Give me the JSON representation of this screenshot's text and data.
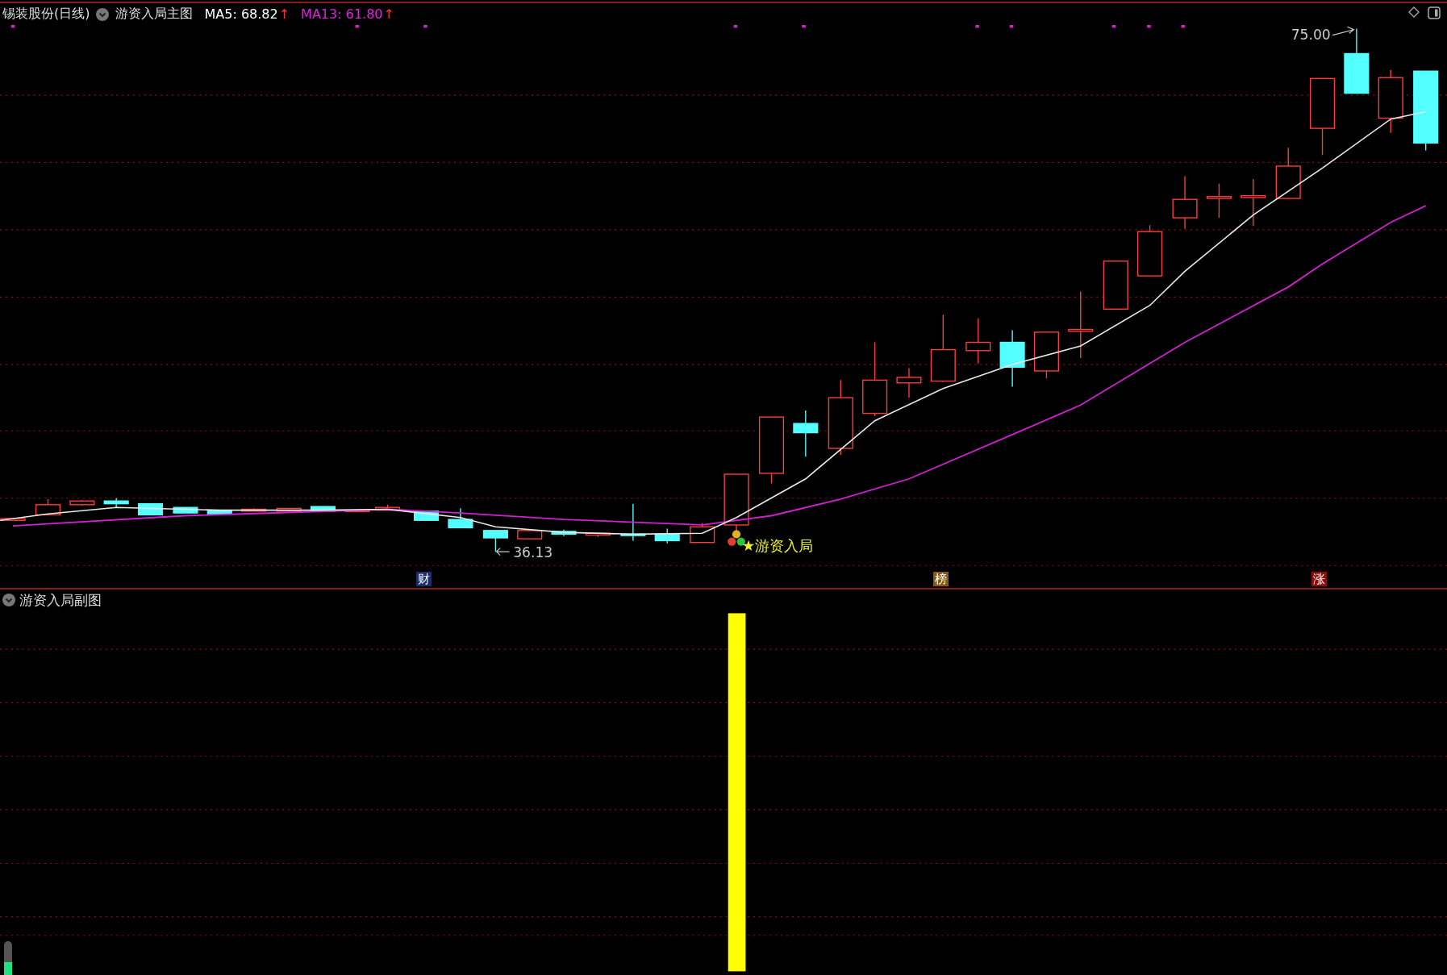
{
  "header": {
    "title": "锡装股份(日线)",
    "indicator": "游资入局主图",
    "ma": [
      {
        "label": "MA5: 68.82",
        "arrow": "↑",
        "color": "#ffffff"
      },
      {
        "label": "MA13: 61.80",
        "arrow": "↑",
        "color": "#e020e0"
      }
    ]
  },
  "main_chart": {
    "high_label": "75.00",
    "low_label": "36.13",
    "signal_label": "★游资入局"
  },
  "markers": [
    {
      "label": "财",
      "color": "#1a2f6a"
    },
    {
      "label": "榜",
      "color": "#8a5a10"
    },
    {
      "label": "涨",
      "color": "#8a1010"
    }
  ],
  "sub_chart": {
    "title": "游资入局副图"
  }
}
